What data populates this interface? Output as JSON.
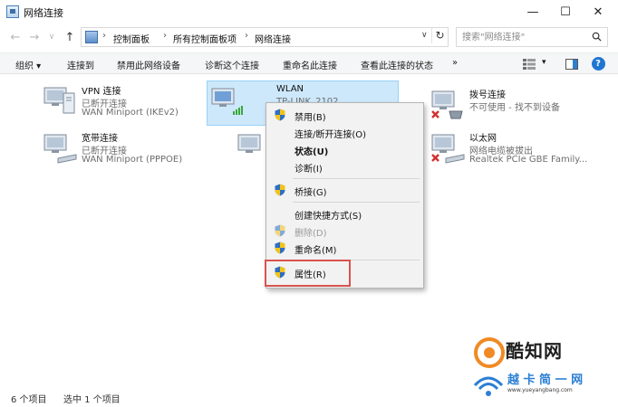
{
  "window": {
    "title": "网络连接",
    "minimize": "—",
    "maximize": "☐",
    "close": "✕"
  },
  "address": {
    "back": "←",
    "forward": "→",
    "recent": "∨",
    "up": "↑",
    "crumbs": [
      "控制面板",
      "所有控制面板项",
      "网络连接"
    ],
    "separator": "›",
    "dropdown": "∨",
    "refresh": "↻",
    "search_placeholder": "搜索\"网络连接\""
  },
  "toolbar": {
    "organize": "组织 ▾",
    "items": [
      "连接到",
      "禁用此网络设备",
      "诊断这个连接",
      "重命名此连接",
      "查看此连接的状态"
    ],
    "more": "»",
    "view_arrow": "▾",
    "help": "?"
  },
  "connections": [
    {
      "name": "VPN 连接",
      "status": "已断开连接",
      "device": "WAN Miniport (IKEv2)"
    },
    {
      "name": "宽带连接",
      "status": "已断开连接",
      "device": "WAN Miniport (PPPOE)"
    },
    {
      "name": "WLAN",
      "status": "TP-LINK_2102",
      "device": ""
    },
    {
      "name": "拨号连接",
      "status": "不可使用 - 找不到设备",
      "device": ""
    },
    {
      "name": "以太网",
      "status": "网络电缆被拔出",
      "device": "Realtek PCIe GBE Family..."
    }
  ],
  "context_menu": {
    "items": [
      {
        "label": "禁用(B)"
      },
      {
        "label": "连接/断开连接(O)"
      },
      {
        "label": "状态(U)"
      },
      {
        "label": "诊断(I)"
      },
      {
        "label": "桥接(G)"
      },
      {
        "label": "创建快捷方式(S)"
      },
      {
        "label": "删除(D)"
      },
      {
        "label": "重命名(M)"
      },
      {
        "label": "属性(R)"
      }
    ]
  },
  "statusbar": {
    "count": "6 个项目",
    "selected": "选中 1 个项目"
  },
  "watermark": {
    "brand": "酷知网",
    "brand2": "越 卡 简 一 网",
    "url": "www.yueyangbang.com"
  },
  "colors": {
    "selection": "#cde8fb",
    "highlight_border": "#d9534f",
    "help_blue": "#1f76d2",
    "error_red": "#d32f2f",
    "watermark_blue": "#2b7fd4",
    "watermark_orange": "#f08a24"
  }
}
